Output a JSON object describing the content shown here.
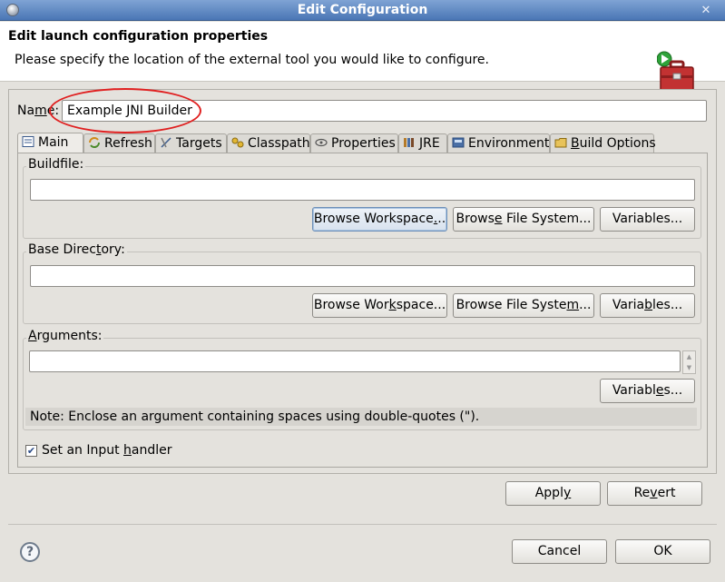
{
  "window": {
    "title": "Edit Configuration"
  },
  "header": {
    "title": "Edit launch configuration properties",
    "description": "Please specify the location of the external tool you would like to configure."
  },
  "name_field": {
    "label_pre": "Na",
    "label_u": "m",
    "label_post": "e:",
    "value": "Example JNI Builder"
  },
  "tabs": [
    {
      "label": "Main",
      "icon": "document-icon"
    },
    {
      "label": "Refresh",
      "icon": "refresh-icon"
    },
    {
      "label": "Targets",
      "icon": "targets-icon"
    },
    {
      "label": "Classpath",
      "icon": "classpath-icon"
    },
    {
      "label": "Properties",
      "icon": "properties-icon"
    },
    {
      "label": "JRE",
      "icon": "jre-icon"
    },
    {
      "label": "Environment",
      "icon": "environment-icon"
    },
    {
      "label_pre": "",
      "label_u": "B",
      "label_post": "uild Options",
      "icon": "folder-icon"
    }
  ],
  "buildfile": {
    "label_pre": "Buildf",
    "label_u": "i",
    "label_post": "le:",
    "value": "",
    "browse_workspace": {
      "pre": "Browse Workspace",
      "u": ".",
      "post": ".."
    },
    "browse_filesystem": {
      "pre": "Brows",
      "u": "e",
      "post": " File System..."
    },
    "variables": {
      "pre": "Variables...",
      "u": "",
      "post": ""
    }
  },
  "base_directory": {
    "label_pre": "Base Direc",
    "label_u": "t",
    "label_post": "ory:",
    "value": "",
    "browse_workspace": {
      "pre": "Browse Wor",
      "u": "k",
      "post": "space..."
    },
    "browse_filesystem": {
      "pre": "Browse File Syste",
      "u": "m",
      "post": "..."
    },
    "variables": {
      "pre": "Varia",
      "u": "b",
      "post": "les..."
    }
  },
  "arguments": {
    "label_pre": "",
    "label_u": "A",
    "label_post": "rguments:",
    "value": "",
    "variables": {
      "pre": "Variabl",
      "u": "e",
      "post": "s..."
    },
    "note": "Note: Enclose an argument containing spaces using double-quotes (\")."
  },
  "input_handler": {
    "checked": true,
    "label_pre": "Set an Input ",
    "label_u": "h",
    "label_post": "andler"
  },
  "actions": {
    "apply": {
      "pre": "Appl",
      "u": "y",
      "post": ""
    },
    "revert": {
      "pre": "Re",
      "u": "v",
      "post": "ert"
    },
    "cancel": "Cancel",
    "ok": "OK"
  },
  "colors": {
    "title_bar": "#4a76b5",
    "annotation_ellipse": "#e02020",
    "accent_green": "#2fa33a"
  }
}
